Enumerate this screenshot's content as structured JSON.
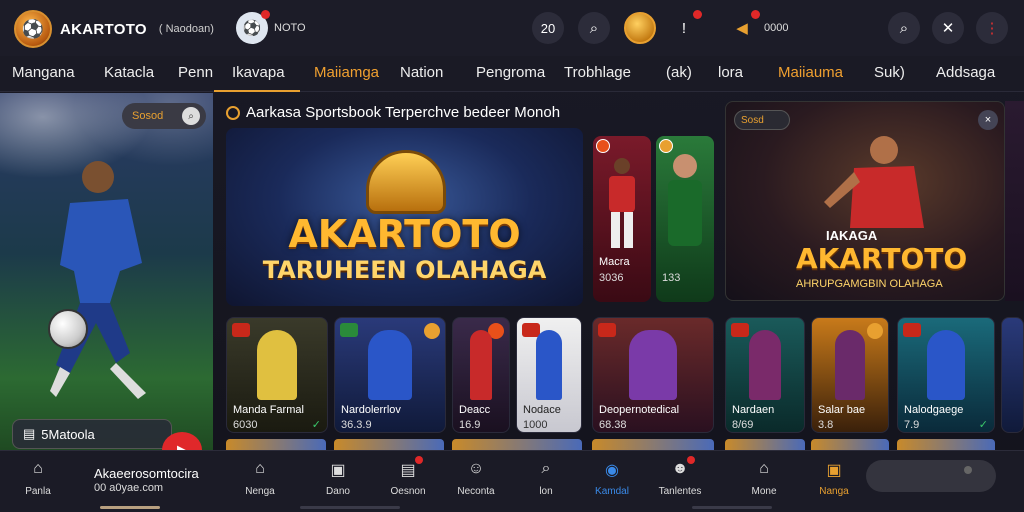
{
  "brand": {
    "name": "AKARTOTO",
    "sub": "( Naodoan)"
  },
  "topbar": {
    "item1_label": "NOTO",
    "item2_value": "20",
    "item3_label": "0000"
  },
  "nav": {
    "items": [
      {
        "label": "Mangana"
      },
      {
        "label": "Katacla"
      },
      {
        "label": "Penn"
      },
      {
        "label": "Ikavapa"
      },
      {
        "label": "Maiiamga"
      },
      {
        "label": "Nation"
      },
      {
        "label": "Pengroma"
      },
      {
        "label": "Trobhlage"
      },
      {
        "label": "(ak)"
      },
      {
        "label": "lora"
      },
      {
        "label": "Maiiauma"
      },
      {
        "label": "Suk)"
      },
      {
        "label": "Addsaga"
      }
    ]
  },
  "left_hero": {
    "search_label": "Sosod",
    "button_label": "5Matoola"
  },
  "section": {
    "title": "Aarkasa Sportsbook Terperchve  bedeer Monoh"
  },
  "main_banner": {
    "title": "AKARTOTO",
    "subtitle": "TARUHEEN OLAHAGA"
  },
  "tall_cards": [
    {
      "name": "Macra",
      "num": "3036"
    },
    {
      "name": "",
      "num": "133"
    }
  ],
  "right_banner": {
    "tag": "Sosd",
    "close_label": "×",
    "line1": "IAKAGA",
    "title": "AKARTOTO",
    "subtitle": "AHRUPGAMGBIN OLAHAGA"
  },
  "game_cards": [
    {
      "name": "Manda Farmal",
      "num": "6030"
    },
    {
      "name": "Nardolerrlov",
      "num": "36.3.9"
    },
    {
      "name": "Deacc",
      "num": "16.9"
    },
    {
      "name": "Nodace",
      "num": "1000"
    },
    {
      "name": "Deopernotedical",
      "num": "68.38"
    },
    {
      "name": "Nardaen",
      "num": "8/69"
    },
    {
      "name": "Salar bae",
      "num": "3.8"
    },
    {
      "name": "Nalodgaege",
      "num": "7.9"
    }
  ],
  "bottom_nav": {
    "promo_line1": "Akaeerosomtocira",
    "promo_line2": "00 a0yae.com",
    "items": [
      {
        "label": "Panla"
      },
      {
        "label": "Nenga"
      },
      {
        "label": "Dano"
      },
      {
        "label": "Oesnon"
      },
      {
        "label": "Neconta"
      },
      {
        "label": "lon"
      },
      {
        "label": "Kamdal"
      },
      {
        "label": "Tanlentes"
      },
      {
        "label": "Mone"
      },
      {
        "label": "Nanga"
      }
    ]
  }
}
